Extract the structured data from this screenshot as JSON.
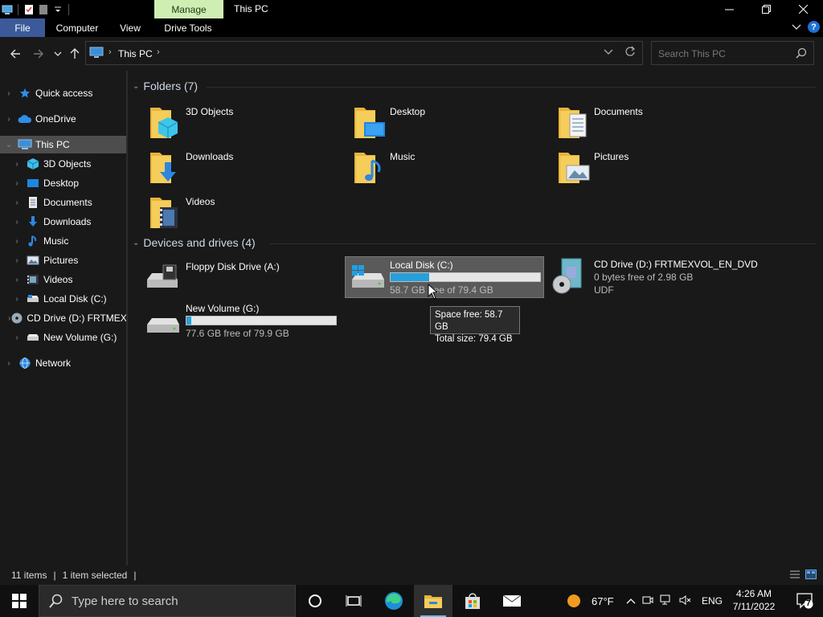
{
  "window": {
    "title": "This PC",
    "contextual_tab": "Manage",
    "controls": {
      "minimize": "—",
      "maximize": "❐",
      "close": "✕"
    }
  },
  "ribbon": {
    "tabs": [
      "File",
      "Computer",
      "View",
      "Drive Tools"
    ],
    "help": "?"
  },
  "address": {
    "crumb": "This PC",
    "search_placeholder": "Search This PC"
  },
  "sidebar": {
    "items": [
      {
        "label": "Quick access",
        "icon": "star-icon"
      },
      {
        "label": "OneDrive",
        "icon": "cloud-icon"
      },
      {
        "label": "This PC",
        "icon": "computer-icon",
        "selected": true
      },
      {
        "label": "3D Objects",
        "icon": "cube-icon"
      },
      {
        "label": "Desktop",
        "icon": "desktop-icon"
      },
      {
        "label": "Documents",
        "icon": "document-icon"
      },
      {
        "label": "Downloads",
        "icon": "download-icon"
      },
      {
        "label": "Music",
        "icon": "music-icon"
      },
      {
        "label": "Pictures",
        "icon": "picture-icon"
      },
      {
        "label": "Videos",
        "icon": "video-icon"
      },
      {
        "label": "Local Disk (C:)",
        "icon": "drive-icon"
      },
      {
        "label": "CD Drive (D:) FRTMEXVOL_EN_DVD",
        "icon": "cd-icon"
      },
      {
        "label": "New Volume (G:)",
        "icon": "drive-icon"
      },
      {
        "label": "Network",
        "icon": "network-icon"
      }
    ]
  },
  "folders": {
    "header": "Folders (7)",
    "items": [
      {
        "label": "3D Objects"
      },
      {
        "label": "Desktop"
      },
      {
        "label": "Documents"
      },
      {
        "label": "Downloads"
      },
      {
        "label": "Music"
      },
      {
        "label": "Pictures"
      },
      {
        "label": "Videos"
      }
    ]
  },
  "drives": {
    "header": "Devices and drives (4)",
    "items": [
      {
        "name": "Floppy Disk Drive (A:)"
      },
      {
        "name": "Local Disk (C:)",
        "free_text": "58.7 GB free of 79.4 GB",
        "used_fraction": 0.26
      },
      {
        "name": "CD Drive (D:) FRTMEXVOL_EN_DVD",
        "line2": "0 bytes free of 2.98 GB",
        "line3": "UDF"
      },
      {
        "name": "New Volume (G:)",
        "free_text": "77.6 GB free of 79.9 GB",
        "used_fraction": 0.03
      }
    ]
  },
  "tooltip": {
    "line1": "Space free: 58.7 GB",
    "line2": "Total size: 79.4 GB"
  },
  "status": {
    "items": "11 items",
    "selected": "1 item selected"
  },
  "taskbar": {
    "search_placeholder": "Type here to search",
    "weather": "67°F",
    "language": "ENG",
    "time": "4:26 AM",
    "date": "7/11/2022",
    "notification_count": "7"
  },
  "colors": {
    "accent": "#26a0da",
    "manage_tab": "#cfeeb4",
    "file_tab": "#3c5a9a",
    "folder": "#f0c24a"
  }
}
